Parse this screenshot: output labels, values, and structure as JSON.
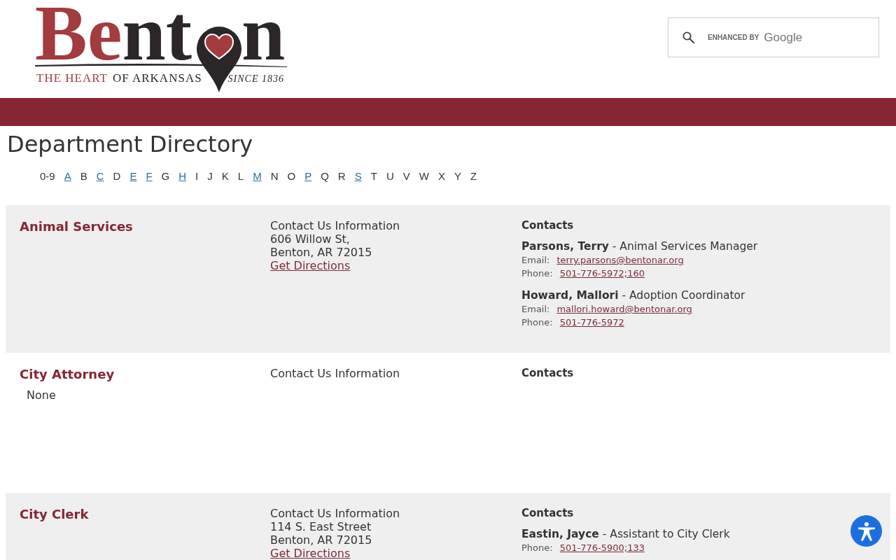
{
  "header": {
    "logo": {
      "wordmark": [
        {
          "text": "Be",
          "accent": true
        },
        {
          "text": "nt",
          "accent": false
        }
      ],
      "wordmark_end": "n",
      "tagline": [
        {
          "text": "THE HEART",
          "accent": true
        },
        {
          "text": "OF ARKANSAS",
          "accent": false
        }
      ],
      "since": "SINCE 1836"
    },
    "search": {
      "branding_label": "ENHANCED BY",
      "branding_name": "Google"
    }
  },
  "page_title": "Department Directory",
  "alphabet": [
    {
      "label": "0-9",
      "linked": false
    },
    {
      "label": "A",
      "linked": true
    },
    {
      "label": "B",
      "linked": false
    },
    {
      "label": "C",
      "linked": true
    },
    {
      "label": "D",
      "linked": false
    },
    {
      "label": "E",
      "linked": true
    },
    {
      "label": "F",
      "linked": true
    },
    {
      "label": "G",
      "linked": false
    },
    {
      "label": "H",
      "linked": true
    },
    {
      "label": "I",
      "linked": false
    },
    {
      "label": "J",
      "linked": false
    },
    {
      "label": "K",
      "linked": false
    },
    {
      "label": "L",
      "linked": false
    },
    {
      "label": "M",
      "linked": true
    },
    {
      "label": "N",
      "linked": false
    },
    {
      "label": "O",
      "linked": false
    },
    {
      "label": "P",
      "linked": true
    },
    {
      "label": "Q",
      "linked": false
    },
    {
      "label": "R",
      "linked": false
    },
    {
      "label": "S",
      "linked": true
    },
    {
      "label": "T",
      "linked": false
    },
    {
      "label": "U",
      "linked": false
    },
    {
      "label": "V",
      "linked": false
    },
    {
      "label": "W",
      "linked": false
    },
    {
      "label": "X",
      "linked": false
    },
    {
      "label": "Y",
      "linked": false
    },
    {
      "label": "Z",
      "linked": false
    }
  ],
  "departments": [
    {
      "name": "Animal Services",
      "shaded": true,
      "contact_heading": "Contact Us Information",
      "address_lines": [
        "606 Willow St,",
        "Benton, AR 72015"
      ],
      "directions_link": "Get Directions",
      "contacts_heading": "Contacts",
      "contacts": [
        {
          "line": "**Parsons, Terry** - Animal Services Manager",
          "email_label": "Email:",
          "email": "terry.parsons@bentonar.org",
          "phone_label": "Phone:",
          "phone": "501-776-5972;160"
        },
        {
          "line": "**Howard, Mallori** - Adoption Coordinator",
          "email_label": "Email:",
          "email": "mallori.howard@bentonar.org",
          "phone_label": "Phone:",
          "phone": "501-776-5972"
        }
      ]
    },
    {
      "name": "City Attorney",
      "shaded": false,
      "note": "None",
      "contact_heading": "Contact Us Information",
      "contacts_heading": "Contacts"
    },
    {
      "name": "City Clerk",
      "shaded": true,
      "contact_heading": "Contact Us Information",
      "address_lines": [
        "114 S. East Street",
        "Benton, AR 72015"
      ],
      "directions_link": "Get Directions",
      "contacts_heading": "Contacts",
      "contacts": [
        {
          "line": "**Eastin, Jayce** - Assistant to City Clerk",
          "phone_label": "Phone:",
          "phone": "501-776-5900;133"
        }
      ]
    }
  ]
}
